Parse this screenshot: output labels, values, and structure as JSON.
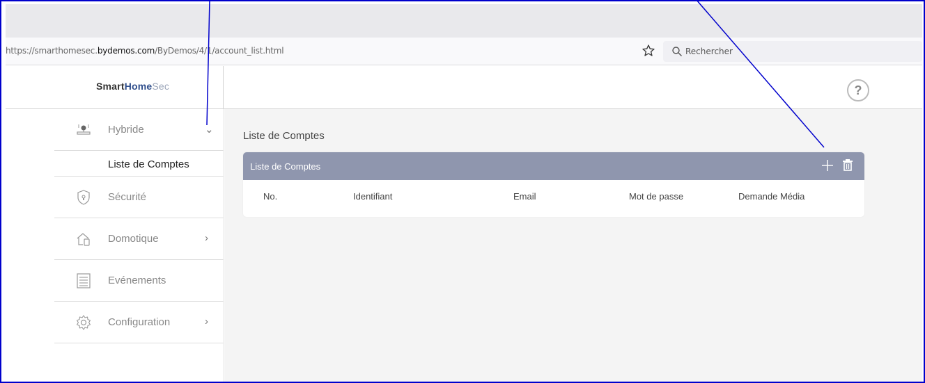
{
  "browser": {
    "url_prefix": "https://smarthomesec.",
    "url_host": "bydemos.com",
    "url_path": "/ByDemos/4/1/account_list.html",
    "search_placeholder": "Rechercher",
    "star_icon": "bookmark-star-icon",
    "search_icon": "magnifier-icon"
  },
  "app": {
    "logo_part1": "Smart",
    "logo_part2": "Home",
    "logo_part3": "Sec",
    "help_label": "?",
    "accent_color": "#8f96ae"
  },
  "sidebar": {
    "items": [
      {
        "label": "Hybride",
        "icon": "hybrid-device-icon",
        "chevron": "⌄"
      },
      {
        "label": "Sécurité",
        "icon": "shield-icon",
        "chevron": ""
      },
      {
        "label": "Domotique",
        "icon": "home-automation-icon",
        "chevron": "›"
      },
      {
        "label": "Evénements",
        "icon": "event-list-icon",
        "chevron": ""
      },
      {
        "label": "Configuration",
        "icon": "gear-icon",
        "chevron": "›"
      }
    ],
    "subitem": "Liste de Comptes"
  },
  "main": {
    "page_title": "Liste de Comptes",
    "panel_title": "Liste de Comptes",
    "columns": [
      "No.",
      "Identifiant",
      "Email",
      "Mot de passe",
      "Demande Média"
    ]
  }
}
